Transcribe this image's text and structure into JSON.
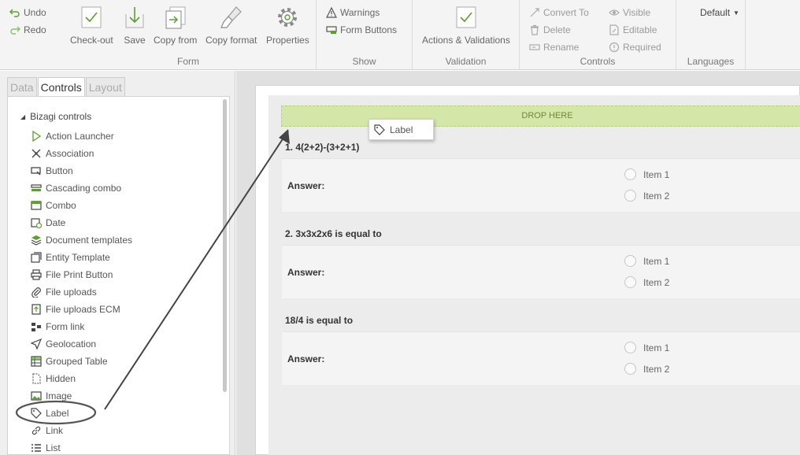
{
  "ribbon": {
    "undo": "Undo",
    "redo": "Redo",
    "form": {
      "label": "Form",
      "checkout": "Check-out",
      "save": "Save",
      "copy_from": "Copy from",
      "copy_format": "Copy format",
      "properties": "Properties"
    },
    "show": {
      "label": "Show",
      "warnings": "Warnings",
      "form_buttons": "Form Buttons"
    },
    "validation": {
      "label": "Validation",
      "actions": "Actions & Validations"
    },
    "controls": {
      "label": "Controls",
      "convert_to": "Convert To",
      "delete": "Delete",
      "rename": "Rename",
      "visible": "Visible",
      "editable": "Editable",
      "required": "Required"
    },
    "languages": {
      "label": "Languages",
      "selected": "Default"
    }
  },
  "panel": {
    "tabs": [
      "Data",
      "Controls",
      "Layout"
    ],
    "root": "Bizagi controls",
    "items": [
      {
        "label": "Action Launcher",
        "icon": "play-icon"
      },
      {
        "label": "Association",
        "icon": "association-icon"
      },
      {
        "label": "Button",
        "icon": "button-icon"
      },
      {
        "label": "Cascading combo",
        "icon": "cascading-combo-icon"
      },
      {
        "label": "Combo",
        "icon": "combo-icon"
      },
      {
        "label": "Date",
        "icon": "calendar-icon"
      },
      {
        "label": "Document templates",
        "icon": "document-templates-icon"
      },
      {
        "label": "Entity Template",
        "icon": "entity-template-icon"
      },
      {
        "label": "File Print Button",
        "icon": "printer-icon"
      },
      {
        "label": "File uploads",
        "icon": "paperclip-icon"
      },
      {
        "label": "File uploads ECM",
        "icon": "upload-ecm-icon"
      },
      {
        "label": "Form link",
        "icon": "form-link-icon"
      },
      {
        "label": "Geolocation",
        "icon": "geolocation-icon"
      },
      {
        "label": "Grouped Table",
        "icon": "grouped-table-icon"
      },
      {
        "label": "Hidden",
        "icon": "hidden-icon"
      },
      {
        "label": "Image",
        "icon": "image-icon"
      },
      {
        "label": "Label",
        "icon": "tag-icon"
      },
      {
        "label": "Link",
        "icon": "link-icon"
      },
      {
        "label": "List",
        "icon": "list-icon"
      }
    ]
  },
  "form": {
    "drop_here": "DROP HERE",
    "drag_label": "Label",
    "questions": [
      {
        "text": "1. 4(2+2)-(3+2+1)",
        "answer_label": "Answer:",
        "options": [
          "Item 1",
          "Item 2"
        ]
      },
      {
        "text": "2. 3x3x2x6 is equal to",
        "answer_label": "Answer:",
        "options": [
          "Item 1",
          "Item 2"
        ]
      },
      {
        "text": "18/4 is equal to",
        "answer_label": "Answer:",
        "options": [
          "Item 1",
          "Item 2"
        ]
      }
    ]
  },
  "colors": {
    "accent_green": "#5aa02c",
    "drop_zone": "#d4e6a8",
    "annotation": "#333333"
  }
}
